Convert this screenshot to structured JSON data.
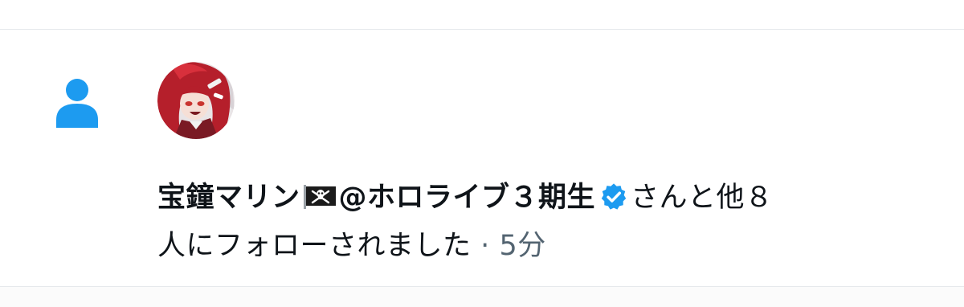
{
  "notification": {
    "type_icon": "person-icon",
    "avatar_icon": "avatar",
    "user_name": "宝鐘マリン",
    "flag_icon": "pirate-flag-icon",
    "user_name_suffix": "@ホロライブ３期生",
    "verified_icon": "verified-badge-icon",
    "message_part1": "さんと他８",
    "message_part2": "人にフォローされました",
    "separator": "·",
    "timestamp": "5分"
  },
  "colors": {
    "accent": "#1d9bf0",
    "text": "#0f1419",
    "secondary_text": "#536471",
    "divider": "#e6e9ec"
  }
}
